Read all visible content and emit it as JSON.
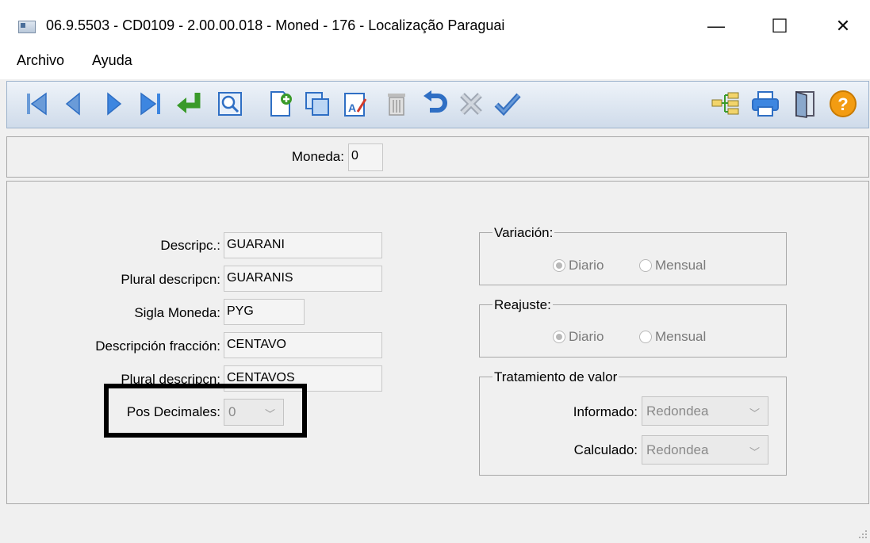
{
  "window": {
    "title": "06.9.5503 - CD0109 - 2.00.00.018 - Moned - 176 - Localização Paraguai",
    "minimize_glyph": "—",
    "maximize_glyph": "☐",
    "close_glyph": "✕"
  },
  "menu": {
    "items": [
      "Archivo",
      "Ayuda"
    ]
  },
  "toolbar": {
    "icons": [
      "first-record-icon",
      "previous-record-icon",
      "next-record-icon",
      "last-record-icon",
      "goto-record-icon",
      "search-icon",
      "new-record-icon",
      "copy-record-icon",
      "edit-record-icon",
      "delete-record-icon",
      "undo-icon",
      "cancel-icon",
      "confirm-icon",
      "tree-icon",
      "print-icon",
      "exit-icon",
      "help-icon"
    ],
    "help_glyph": "?"
  },
  "header": {
    "moneda_label": "Moneda:",
    "moneda_value": "0"
  },
  "form": {
    "descripc_label": "Descripc.:",
    "descripc_value": "GUARANI",
    "plural_label": "Plural descripcn:",
    "plural_value": "GUARANIS",
    "sigla_label": "Sigla Moneda:",
    "sigla_value": "PYG",
    "fraccion_label": "Descripción fracción:",
    "fraccion_value": "CENTAVO",
    "plural_fraccion_label": "Plural descripcn:",
    "plural_fraccion_value": "CENTAVOS",
    "pos_decimales_label": "Pos Decimales:",
    "pos_decimales_value": "0"
  },
  "variacion": {
    "legend": "Variación:",
    "options": [
      "Diario",
      "Mensual"
    ],
    "selected": "Diario"
  },
  "reajuste": {
    "legend": "Reajuste:",
    "options": [
      "Diario",
      "Mensual"
    ],
    "selected": "Diario"
  },
  "tratamiento": {
    "legend": "Tratamiento de valor",
    "informado_label": "Informado:",
    "informado_value": "Redondea",
    "calculado_label": "Calculado:",
    "calculado_value": "Redondea"
  },
  "colors": {
    "toolbar_blue": "#2f6fc4",
    "toolbar_green": "#3a9a2a",
    "help_orange": "#f39c12",
    "highlight": "#000000"
  }
}
